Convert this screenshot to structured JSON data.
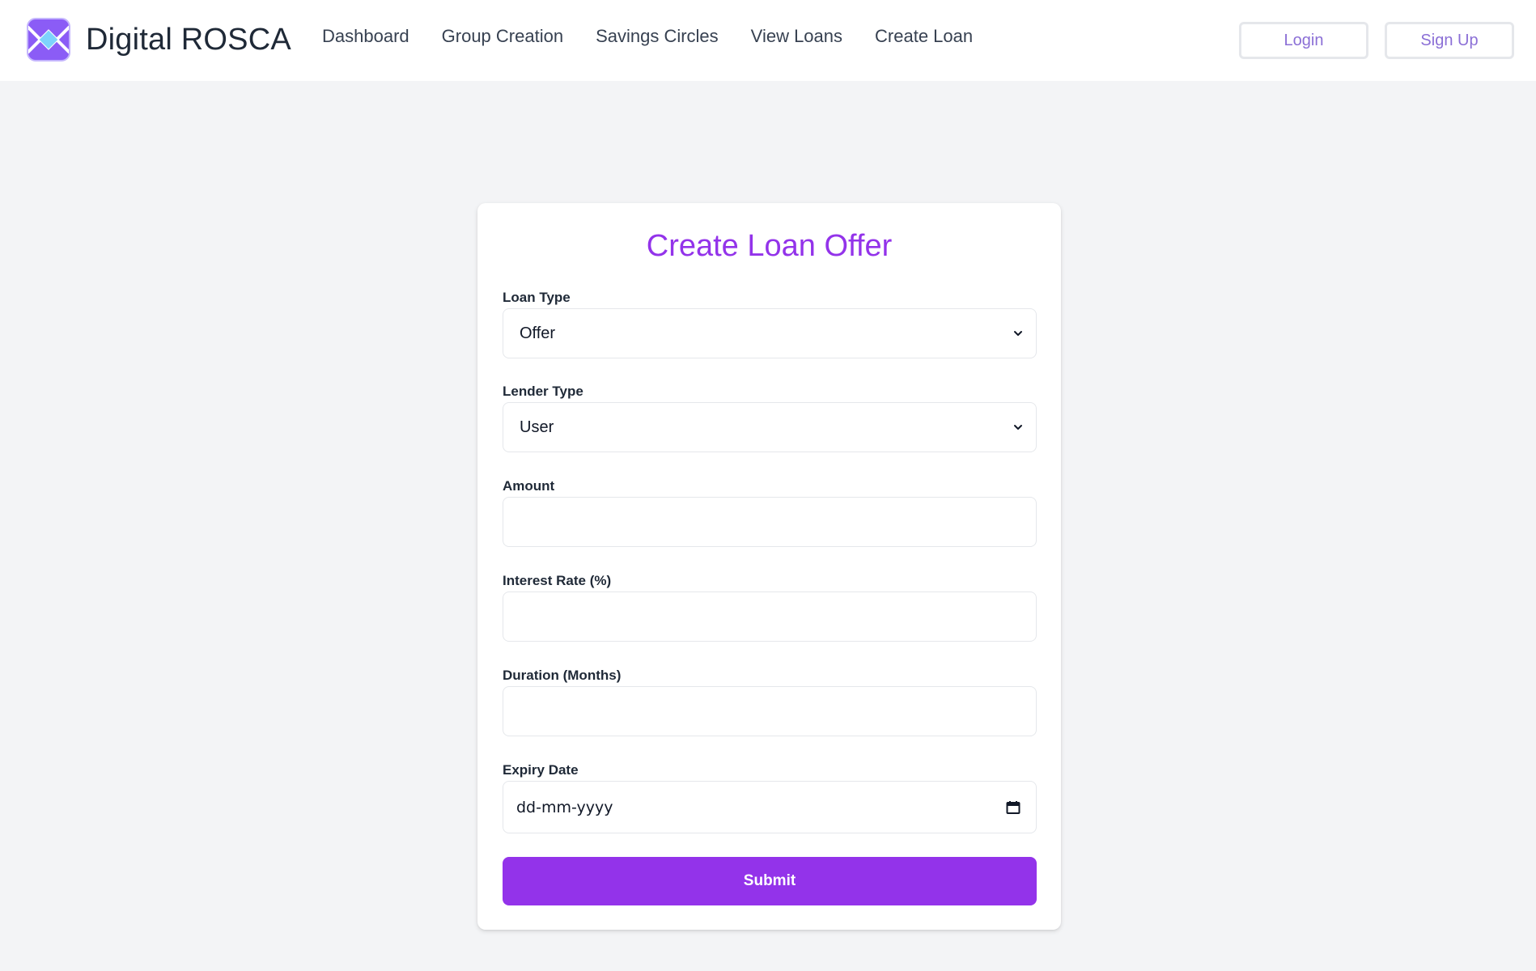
{
  "brand": {
    "name": "Digital ROSCA",
    "logo_icon": "rosca-logo-icon"
  },
  "nav": {
    "items": [
      {
        "label": "Dashboard"
      },
      {
        "label": "Group Creation"
      },
      {
        "label": "Savings Circles"
      },
      {
        "label": "View Loans"
      },
      {
        "label": "Create Loan"
      }
    ]
  },
  "auth": {
    "login_label": "Login",
    "signup_label": "Sign Up"
  },
  "form": {
    "title": "Create Loan Offer",
    "loan_type": {
      "label": "Loan Type",
      "value": "Offer"
    },
    "lender_type": {
      "label": "Lender Type",
      "value": "User"
    },
    "amount": {
      "label": "Amount",
      "value": ""
    },
    "interest_rate": {
      "label": "Interest Rate (%)",
      "value": ""
    },
    "duration": {
      "label": "Duration (Months)",
      "value": ""
    },
    "expiry_date": {
      "label": "Expiry Date",
      "placeholder": "dd-mm-yyyy"
    },
    "submit_label": "Submit"
  },
  "colors": {
    "accent": "#9333ea",
    "auth_text": "#8b6fd6",
    "background": "#f3f4f6"
  }
}
